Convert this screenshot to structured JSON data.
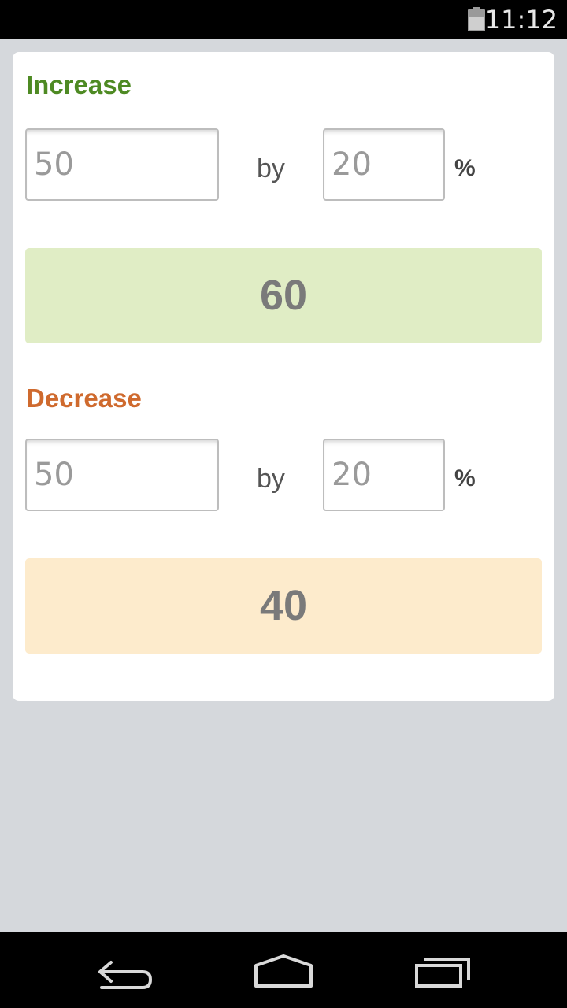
{
  "status_bar": {
    "time": "11:12",
    "battery_icon": "battery-icon"
  },
  "increase": {
    "title": "Increase",
    "title_color": "#4e8a23",
    "value": "50",
    "by_label": "by",
    "percent": "20",
    "percent_label": "%",
    "result": "60",
    "result_bg": "#e0edc5"
  },
  "decrease": {
    "title": "Decrease",
    "title_color": "#cf6a2e",
    "value": "50",
    "by_label": "by",
    "percent": "20",
    "percent_label": "%",
    "result": "40",
    "result_bg": "#fdebcc"
  },
  "nav_bar": {
    "icons": [
      "back-icon",
      "home-icon",
      "recent-apps-icon"
    ]
  }
}
